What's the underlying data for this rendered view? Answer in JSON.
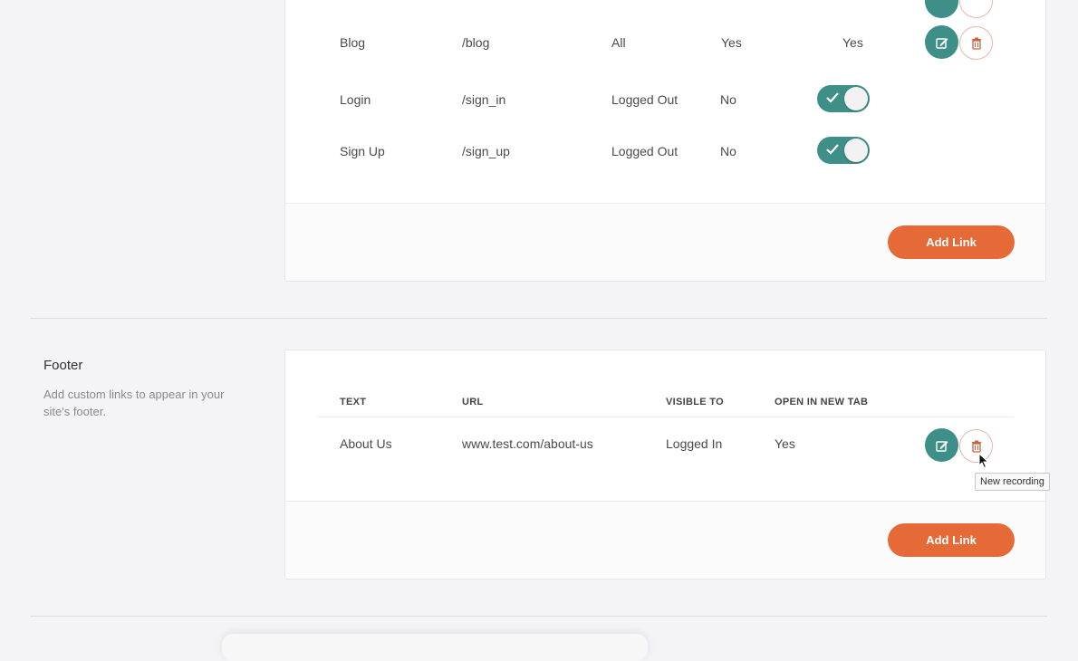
{
  "header_links": {
    "rows": [
      {
        "text": "Blog",
        "url": "/blog",
        "visible_to": "All",
        "new_tab": "Yes",
        "default_col": "Yes",
        "type": "custom"
      },
      {
        "text": "Login",
        "url": "/sign_in",
        "visible_to": "Logged Out",
        "new_tab": "No",
        "type": "toggle",
        "toggle_on": true
      },
      {
        "text": "Sign Up",
        "url": "/sign_up",
        "visible_to": "Logged Out",
        "new_tab": "No",
        "type": "toggle",
        "toggle_on": true
      }
    ],
    "add_link_label": "Add Link"
  },
  "footer": {
    "title": "Footer",
    "description": "Add custom links to appear in your site's footer.",
    "columns": {
      "text": "TEXT",
      "url": "URL",
      "visible_to": "VISIBLE TO",
      "new_tab": "OPEN IN NEW TAB"
    },
    "rows": [
      {
        "text": "About Us",
        "url": "www.test.com/about-us",
        "visible_to": "Logged In",
        "new_tab": "Yes"
      }
    ],
    "add_link_label": "Add Link"
  },
  "tooltip": {
    "text": "New recording"
  },
  "colors": {
    "accent": "#3d8f88",
    "primary_button": "#e56a37",
    "delete": "#d0603e"
  },
  "icons": {
    "edit": "edit-icon",
    "delete": "trash-icon",
    "check": "check-icon",
    "cursor": "cursor-icon"
  }
}
